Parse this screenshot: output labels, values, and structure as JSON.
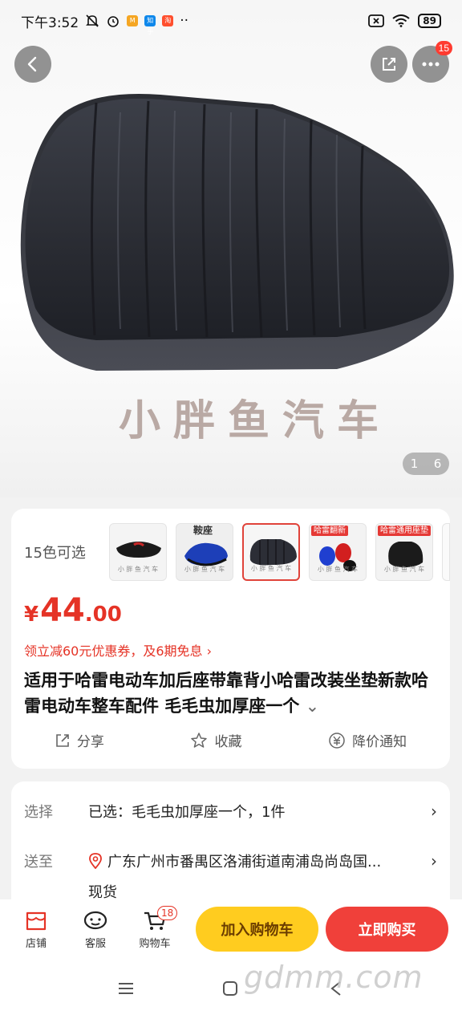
{
  "status_bar": {
    "time": "下午3:52",
    "battery": "89",
    "mini_apps": [
      {
        "label": "M",
        "color": "#f5a623"
      },
      {
        "label": "知乎",
        "color": "#0f88eb"
      },
      {
        "label": "淘",
        "color": "#ff4f2e"
      }
    ],
    "more": "··"
  },
  "hero": {
    "watermark": "小胖鱼汽车",
    "page_current": "1",
    "page_total": "6",
    "more_badge": "15"
  },
  "product": {
    "colors_label": "15色可选",
    "thumbs": [
      {
        "tag": "",
        "wm": "小 胖 鱼 汽 车"
      },
      {
        "tag": "鞍座",
        "wm": "小 胖 鱼 汽 车"
      },
      {
        "tag": "",
        "wm": "小 胖 鱼 汽 车"
      },
      {
        "tag": "哈雷翻新",
        "wm": "小 胖 鱼 汽 车"
      },
      {
        "tag": "哈雷通用座垫",
        "wm": "小 胖 鱼 汽 车"
      }
    ],
    "selected_thumb": 2,
    "price_symbol": "¥",
    "price_int": "44",
    "price_dec": ".00",
    "coupon": "领立减60元优惠券，及6期免息 ›",
    "title": "适用于哈雷电动车加后座带靠背小哈雷改装坐垫新款哈雷电动车整车配件 毛毛虫加厚座一个",
    "title_arrow": "⌄",
    "actions": {
      "share": "分享",
      "favorite": "收藏",
      "price_alert": "降价通知"
    }
  },
  "spec": {
    "select_label": "选择",
    "select_value": "已选：毛毛虫加厚座一个，1件",
    "ship_label": "送至",
    "ship_value": "广东广州市番禺区洛浦街道南浦岛尚岛国...",
    "stock": "现货",
    "chevron": "›"
  },
  "bottom_bar": {
    "store": "店铺",
    "service": "客服",
    "cart": "购物车",
    "cart_count": "18",
    "add_to_cart": "加入购物车",
    "buy_now": "立即购买"
  },
  "site_watermark": "gdmm.com"
}
